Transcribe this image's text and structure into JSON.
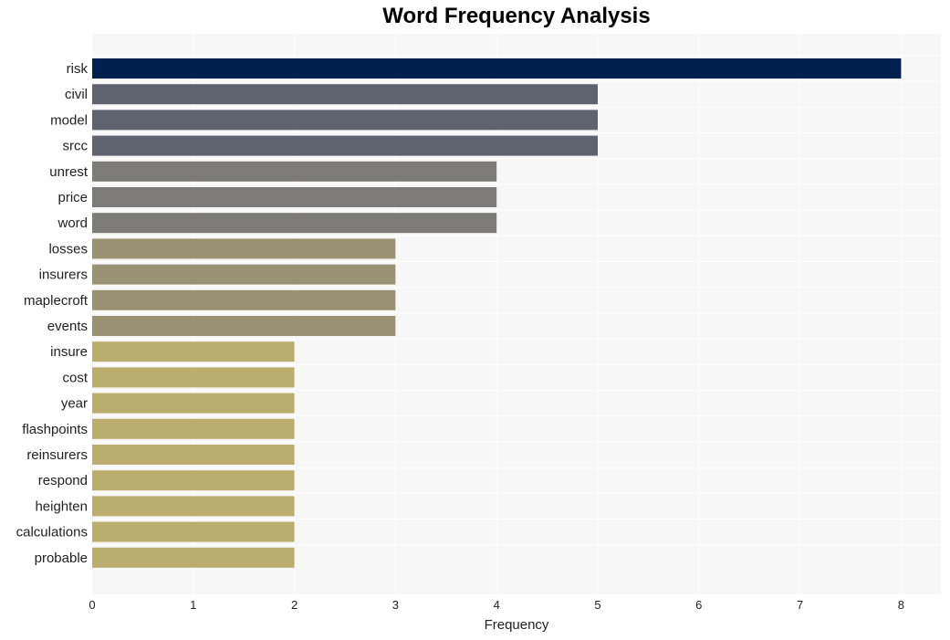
{
  "chart_data": {
    "type": "bar",
    "orientation": "horizontal",
    "title": "Word Frequency Analysis",
    "xlabel": "Frequency",
    "ylabel": "",
    "xlim": [
      0,
      8.4
    ],
    "xticks": [
      0,
      1,
      2,
      3,
      4,
      5,
      6,
      7,
      8
    ],
    "grid": true,
    "categories": [
      "risk",
      "civil",
      "model",
      "srcc",
      "unrest",
      "price",
      "word",
      "losses",
      "insurers",
      "maplecroft",
      "events",
      "insure",
      "cost",
      "year",
      "flashpoints",
      "reinsurers",
      "respond",
      "heighten",
      "calculations",
      "probable"
    ],
    "values": [
      8,
      5,
      5,
      5,
      4,
      4,
      4,
      3,
      3,
      3,
      3,
      2,
      2,
      2,
      2,
      2,
      2,
      2,
      2,
      2
    ],
    "colors_by_value": {
      "8": "#00204e",
      "5": "#5f636d",
      "4": "#7c7b78",
      "3": "#9a9373",
      "2": "#baad6e"
    },
    "background": "#f7f7f7"
  }
}
